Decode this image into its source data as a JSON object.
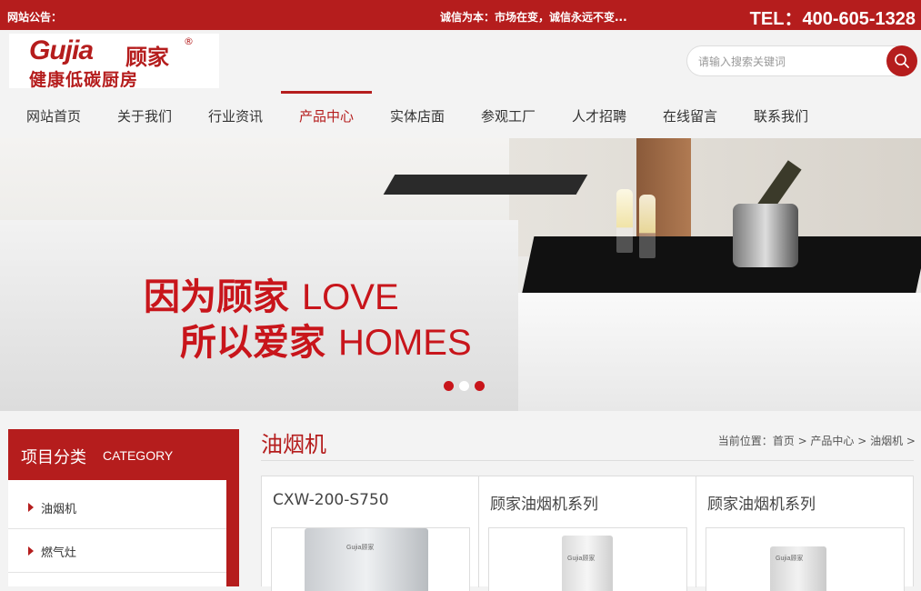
{
  "topbar": {
    "notice_label": "网站公告：",
    "notice_text": "诚信为本：市场在变，诚信永远不变...",
    "tel": "TEL：400-605-1328"
  },
  "logo": {
    "brand": "Gujia",
    "brand_cn": "顾家",
    "reg": "®",
    "slogan": "健康低碳厨房"
  },
  "search": {
    "placeholder": "请输入搜索关键词"
  },
  "nav": {
    "items": [
      "网站首页",
      "关于我们",
      "行业资讯",
      "产品中心",
      "实体店面",
      "参观工厂",
      "人才招聘",
      "在线留言",
      "联系我们"
    ],
    "active_index": 3
  },
  "banner": {
    "line1_cn": "因为顾家",
    "line1_en": "LOVE",
    "line2_cn": "所以爱家",
    "line2_en": "HOMES",
    "slide_count": 3,
    "active_slide": 1
  },
  "sidebar": {
    "title_cn": "项目分类",
    "title_en": "CATEGORY",
    "categories": [
      "油烟机",
      "燃气灶"
    ]
  },
  "content": {
    "title": "油烟机",
    "breadcrumb": "当前位置：首页 > 产品中心 > 油烟机 >",
    "products": [
      {
        "name": "CXW-200-S750",
        "img_label": "Gujia顾家"
      },
      {
        "name": "顾家油烟机系列",
        "img_label": "Gujia顾家"
      },
      {
        "name": "顾家油烟机系列",
        "img_label": "Gujia顾家"
      }
    ]
  },
  "colors": {
    "brand_red": "#b51d1d",
    "slogan_red": "#c8151b",
    "background": "#f3f3f3"
  }
}
